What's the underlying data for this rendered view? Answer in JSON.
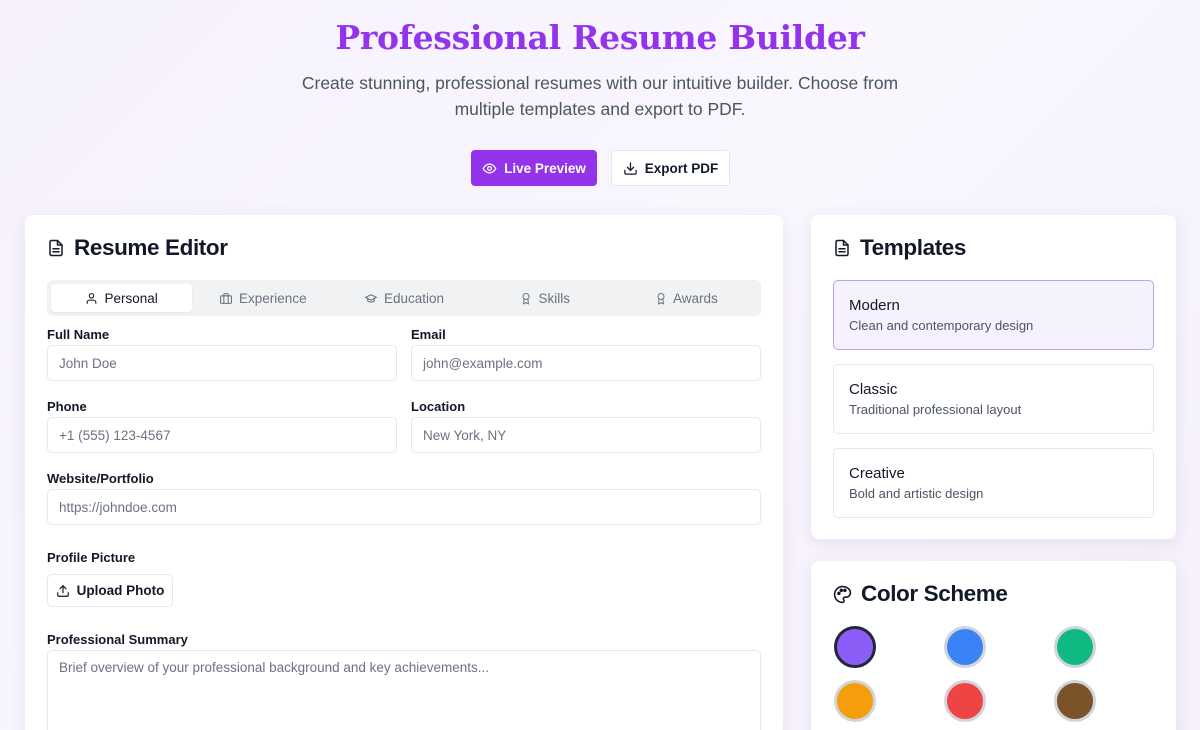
{
  "hero": {
    "title": "Professional Resume Builder",
    "subtitle": "Create stunning, professional resumes with our intuitive builder. Choose from multiple templates and export to PDF.",
    "preview_label": "Live Preview",
    "export_label": "Export PDF",
    "accent_color": "#9333ea"
  },
  "editor": {
    "title": "Resume Editor",
    "tabs": [
      {
        "label": "Personal",
        "icon": "user-icon",
        "active": true
      },
      {
        "label": "Experience",
        "icon": "briefcase-icon",
        "active": false
      },
      {
        "label": "Education",
        "icon": "graduation-cap-icon",
        "active": false
      },
      {
        "label": "Skills",
        "icon": "award-icon",
        "active": false
      },
      {
        "label": "Awards",
        "icon": "award-icon",
        "active": false
      }
    ],
    "fields": {
      "full_name": {
        "label": "Full Name",
        "placeholder": "John Doe",
        "value": ""
      },
      "email": {
        "label": "Email",
        "placeholder": "john@example.com",
        "value": ""
      },
      "phone": {
        "label": "Phone",
        "placeholder": "+1 (555) 123-4567",
        "value": ""
      },
      "location": {
        "label": "Location",
        "placeholder": "New York, NY",
        "value": ""
      },
      "website": {
        "label": "Website/Portfolio",
        "placeholder": "https://johndoe.com",
        "value": ""
      },
      "profile_picture": {
        "label": "Profile Picture",
        "button_label": "Upload Photo"
      },
      "summary": {
        "label": "Professional Summary",
        "placeholder": "Brief overview of your professional background and key achievements...",
        "value": ""
      }
    }
  },
  "templates": {
    "title": "Templates",
    "items": [
      {
        "name": "Modern",
        "description": "Clean and contemporary design",
        "selected": true
      },
      {
        "name": "Classic",
        "description": "Traditional professional layout",
        "selected": false
      },
      {
        "name": "Creative",
        "description": "Bold and artistic design",
        "selected": false
      }
    ]
  },
  "color_scheme": {
    "title": "Color Scheme",
    "swatches": [
      {
        "color": "#8b5cf6",
        "selected": true
      },
      {
        "color": "#3b82f6",
        "selected": false
      },
      {
        "color": "#10b981",
        "selected": false
      },
      {
        "color": "#f59e0b",
        "selected": false
      },
      {
        "color": "#ef4444",
        "selected": false
      },
      {
        "color": "#7c5329",
        "selected": false
      }
    ]
  }
}
